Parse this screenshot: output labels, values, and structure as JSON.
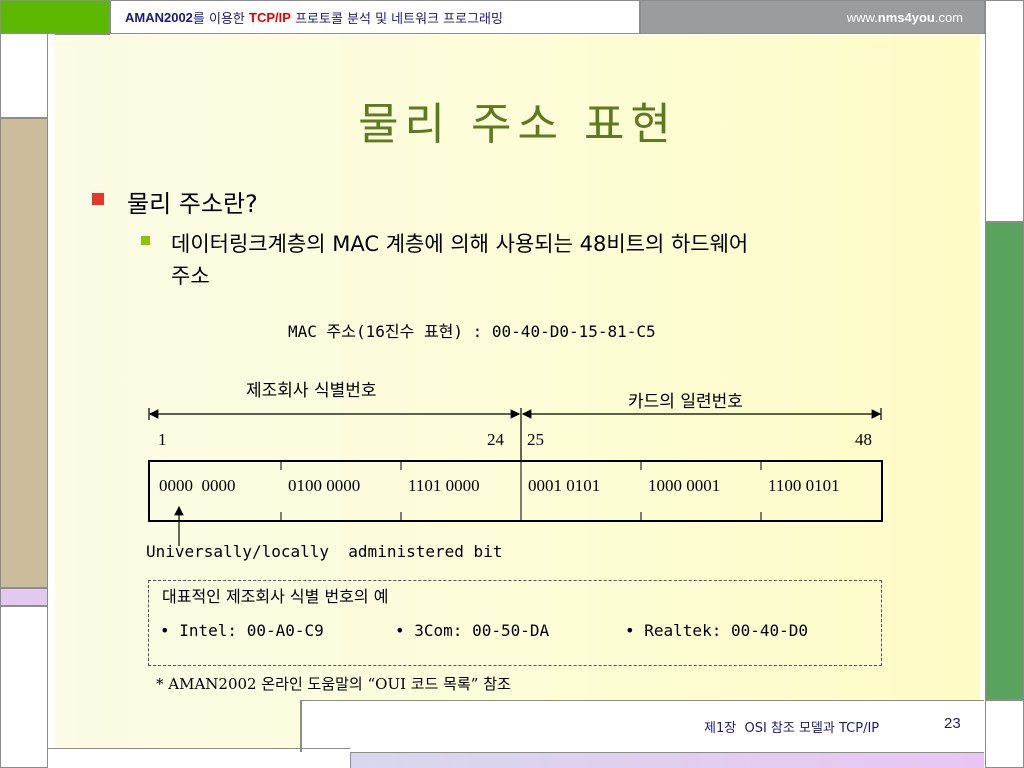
{
  "header": {
    "brand_bold": "AMAN2002",
    "brand_rest_1": "를 이용한 ",
    "brand_tcp": "TCP/IP",
    "brand_rest_2": " 프로토콜 분석 및 네트워크 프로그래밍",
    "site_prefix": "www.",
    "site_bold": "nms4you",
    "site_suffix": ".com"
  },
  "slide": {
    "title": "물리 주소 표현",
    "bullet1": "물리 주소란?",
    "bullet2_line1": "데이터링크계층의 MAC 계층에 의해 사용되는 48비트의 하드웨어",
    "bullet2_line2": "주소"
  },
  "diagram": {
    "mac_caption": "MAC 주소(16진수 표현) : 00-40-D0-15-81-C5",
    "label_vendor": "제조회사 식별번호",
    "label_serial": "카드의 일련번호",
    "bit_1": "1",
    "bit_24": "24",
    "bit_25": "25",
    "bit_48": "48",
    "bytes": [
      "0000  0000",
      "0100 0000",
      "1101 0000",
      "0001 0101",
      "1000 0001",
      "1100 0101"
    ],
    "ul_label": "Universally/locally  administered bit"
  },
  "examples": {
    "heading": "대표적인 제조회사 식별 번호의 예",
    "items": [
      "• Intel: 00-A0-C9",
      "• 3Com: 00-50-DA",
      "• Realtek: 00-40-D0"
    ]
  },
  "note": "* AMAN2002 온라인 도움말의 “OUI 코드 목록” 참조",
  "footer": {
    "chapter": "제1장  OSI 참조 모델과 TCP/IP",
    "page_number": "23"
  },
  "colors": {
    "title": "#5c7a1e",
    "bullet_primary": "#e8342a",
    "bullet_secondary": "#8fc400",
    "brand_red": "#e60000",
    "brand_navy": "#1a1a80"
  }
}
